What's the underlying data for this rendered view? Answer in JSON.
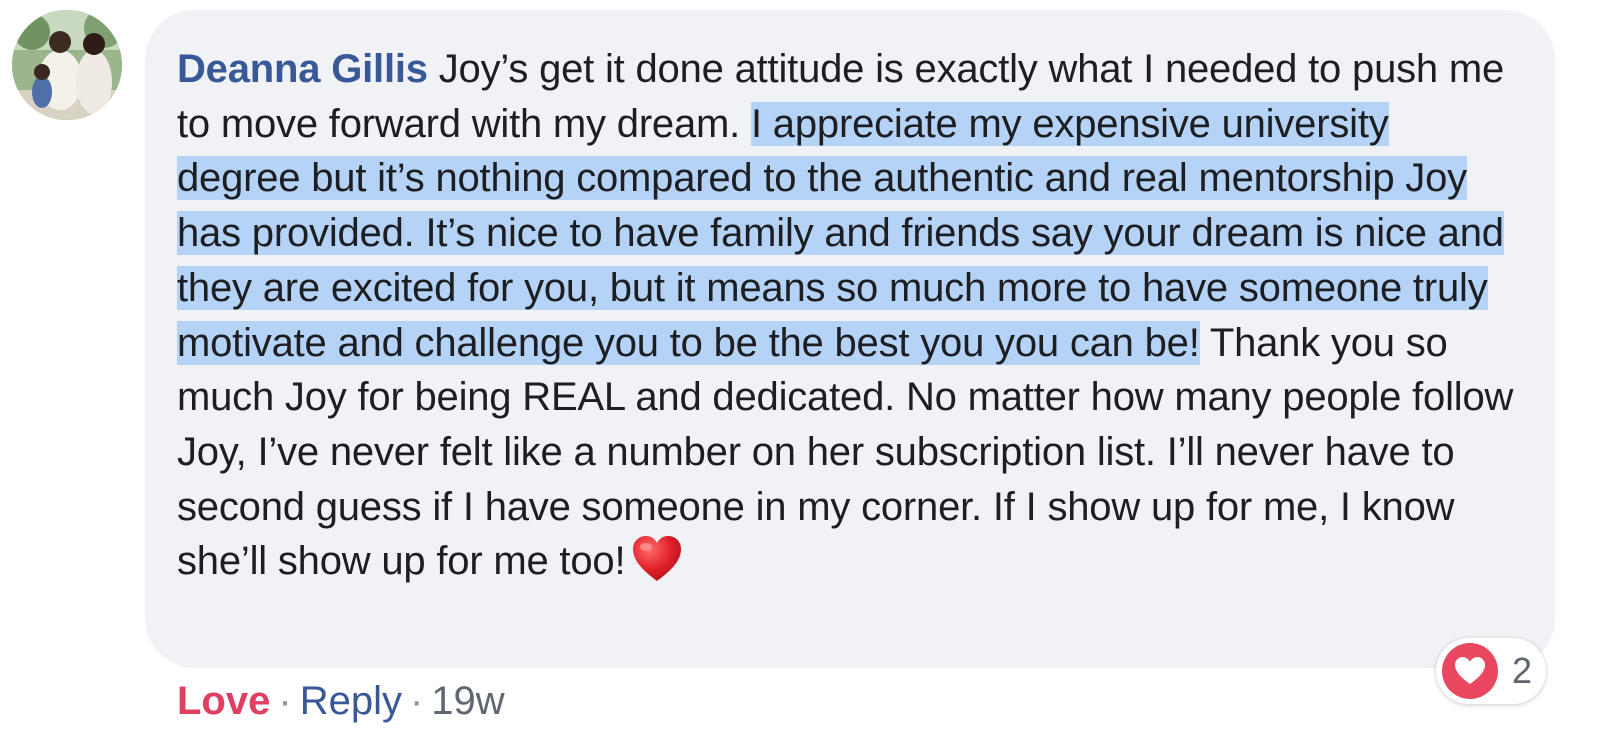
{
  "comment": {
    "author": "Deanna Gillis",
    "text_before": " Joy’s get it done attitude is exactly what I needed to push me to move forward with my dream. ",
    "text_selected": "I appreciate my expensive university degree but it’s nothing compared to the authentic and real mentorship Joy has provided. It’s nice to have family and friends say your dream is nice and they are excited for you, but it means so much more to have someone truly motivate and challenge you to be the best you you can be!",
    "text_after": " Thank you so much Joy for being REAL and dedicated. No matter how many people follow Joy, I’ve never felt like a number on her subscription list. I’ll never have to second guess if I have someone in my corner. If I show up for me, I know she’ll show up for me too!",
    "emoji_icon": "red-heart-icon"
  },
  "actions": {
    "love": "Love",
    "separator": "·",
    "reply": "Reply",
    "time": "19w"
  },
  "reactions": {
    "icon": "love-reaction-icon",
    "count": "2"
  },
  "colors": {
    "author": "#385898",
    "love": "#e0405f",
    "selection": "#b5d3f7",
    "bubble": "#f0f2f5"
  }
}
